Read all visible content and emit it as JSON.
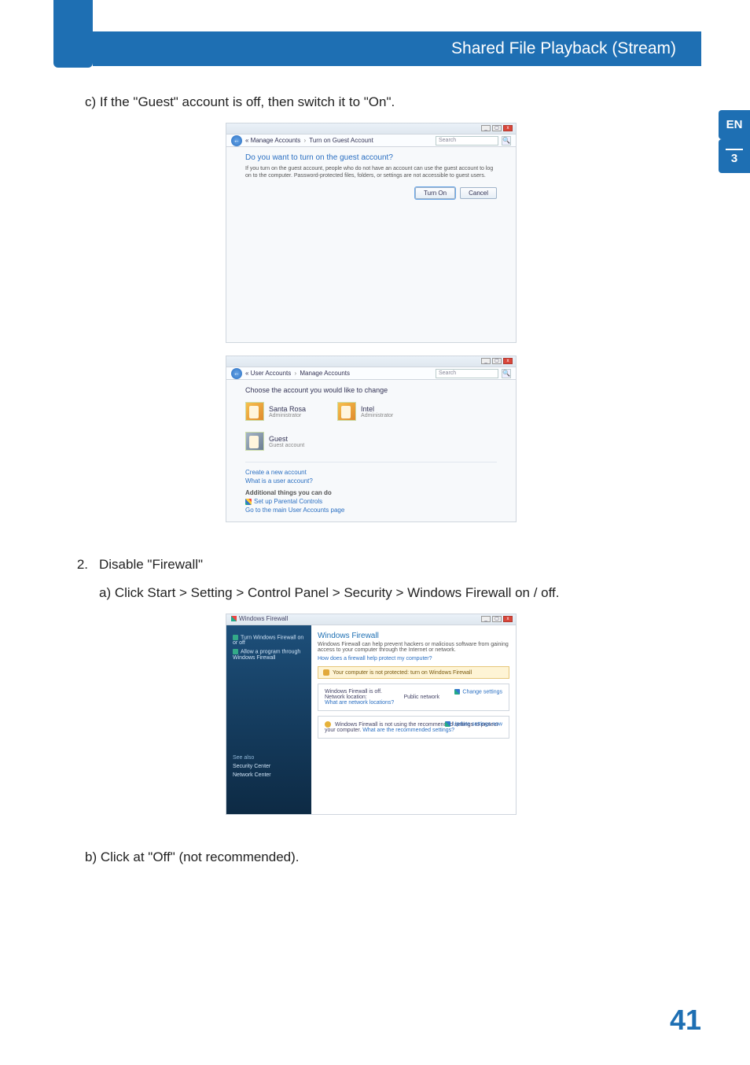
{
  "header": {
    "title": "Shared File Playback (Stream)"
  },
  "sidetab": {
    "lang": "EN",
    "chapter": "3"
  },
  "page_number": "41",
  "step_c": "c) If the \"Guest\" account is off, then switch it to \"On\".",
  "shot1": {
    "window_btn_min": "_",
    "window_btn_max": "▢",
    "window_btn_close": "x",
    "back": "←",
    "path1": "Manage Accounts",
    "path2": "Turn on Guest Account",
    "sep": "›",
    "search_placeholder": "Search",
    "mag": "🔍",
    "question": "Do you want to turn on the guest account?",
    "desc": "If you turn on the guest account, people who do not have an account can use the guest account to log on to the computer. Password-protected files, folders, or settings are not accessible to guest users.",
    "btn_turn_on": "Turn On",
    "btn_cancel": "Cancel"
  },
  "shot2": {
    "path1": "User Accounts",
    "path2": "Manage Accounts",
    "sep": "›",
    "search_placeholder": "Search",
    "heading": "Choose the account you would like to change",
    "acct1_name": "Santa Rosa",
    "acct1_sub": "Administrator",
    "acct2_name": "Intel",
    "acct2_sub": "Administrator",
    "acct3_name": "Guest",
    "acct3_sub": "Guest account",
    "link_create": "Create a new account",
    "link_what": "What is a user account?",
    "things_hd": "Additional things you can do",
    "link_parental": "Set up Parental Controls",
    "link_main": "Go to the main User Accounts page"
  },
  "step2_num": "2.",
  "step2_title": "Disable \"Firewall\"",
  "step2_a": "a) Click Start > Setting > Control Panel > Security > Windows Firewall on / off.",
  "shot3": {
    "window_title": "Windows Firewall",
    "side_link1": "Turn Windows Firewall on or off",
    "side_link2": "Allow a program through Windows Firewall",
    "seealso_hd": "See also",
    "seealso1": "Security Center",
    "seealso2": "Network Center",
    "panel_title": "Windows Firewall",
    "panel_desc": "Windows Firewall can help prevent hackers or malicious software from gaining access to your computer through the Internet or network.",
    "panel_how": "How does a firewall help protect my computer?",
    "warn": "Your computer is not protected: turn on Windows Firewall",
    "card1_l1": "Windows Firewall is off.",
    "card1_l2": "Network location:",
    "card1_val": "Public network",
    "card1_link": "What are network locations?",
    "card1_right": "Change settings",
    "card2_text": "Windows Firewall is not using the recommended settings to protect your computer.",
    "card2_what": "What are the recommended settings?",
    "card2_right": "Update settings now"
  },
  "step2_b": "b) Click at \"Off\" (not recommended)."
}
